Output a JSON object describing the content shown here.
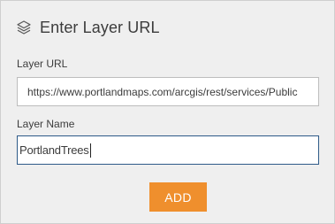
{
  "header": {
    "title": "Enter Layer URL",
    "icon": "layers-icon"
  },
  "form": {
    "url_label": "Layer URL",
    "url_value": "https://www.portlandmaps.com/arcgis/rest/services/Public",
    "name_label": "Layer Name",
    "name_value": "PortlandTrees"
  },
  "actions": {
    "add_label": "ADD"
  },
  "colors": {
    "accent": "#ef8f2d",
    "panel_bg": "#efefef",
    "focus_border": "#2e5a88"
  }
}
